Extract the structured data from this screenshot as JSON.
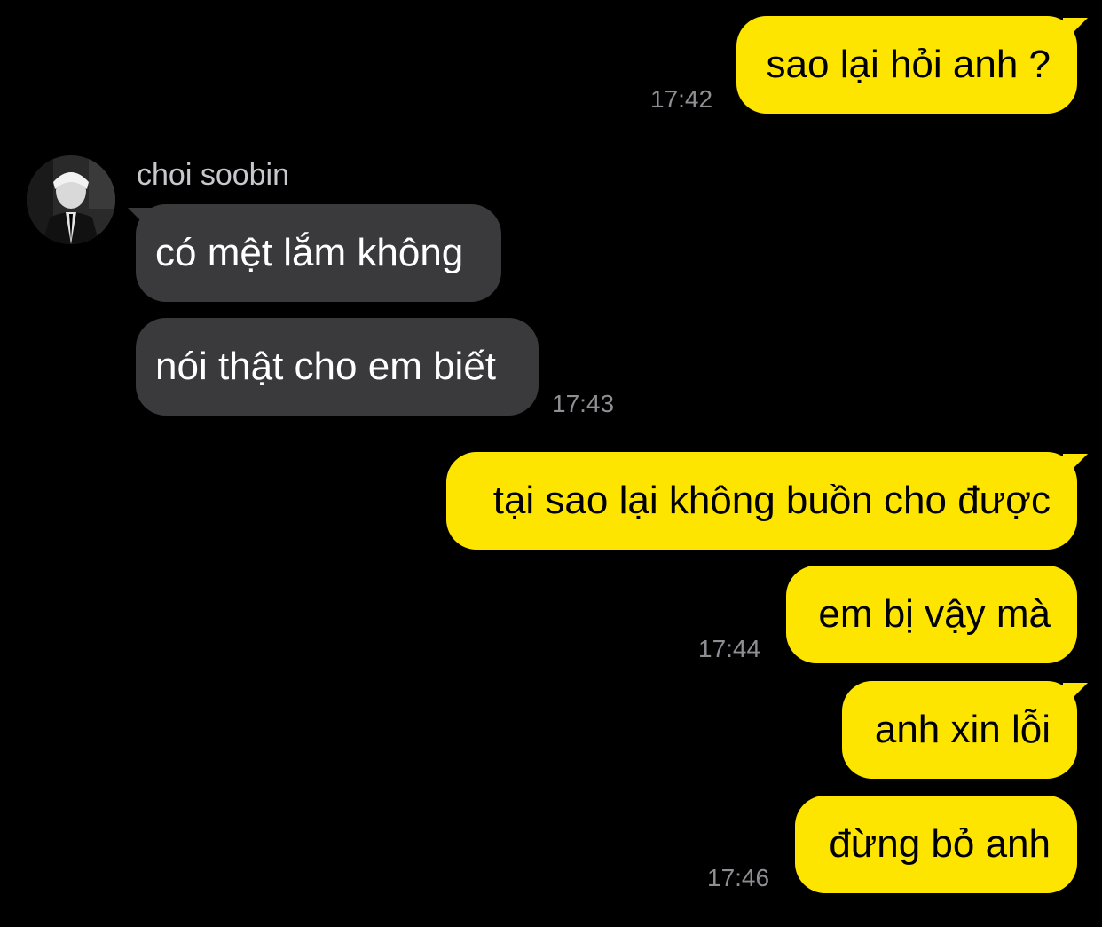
{
  "colors": {
    "background": "#000000",
    "sent_bubble": "#FEE500",
    "received_bubble": "#3A3A3C",
    "timestamp": "#8E8E93"
  },
  "contact": {
    "name": "choi soobin",
    "avatar_icon": "profile-photo"
  },
  "messages": [
    {
      "side": "sent",
      "text": "sao lại hỏi anh ?",
      "time": "17:42"
    },
    {
      "side": "received",
      "text": "có mệt lắm không"
    },
    {
      "side": "received",
      "text": "nói thật cho em biết",
      "time": "17:43"
    },
    {
      "side": "sent",
      "text": "tại sao lại không buồn cho được"
    },
    {
      "side": "sent",
      "text": "em bị vậy mà",
      "time": "17:44"
    },
    {
      "side": "sent",
      "text": "anh xin lỗi"
    },
    {
      "side": "sent",
      "text": "đừng bỏ anh",
      "time": "17:46"
    }
  ]
}
